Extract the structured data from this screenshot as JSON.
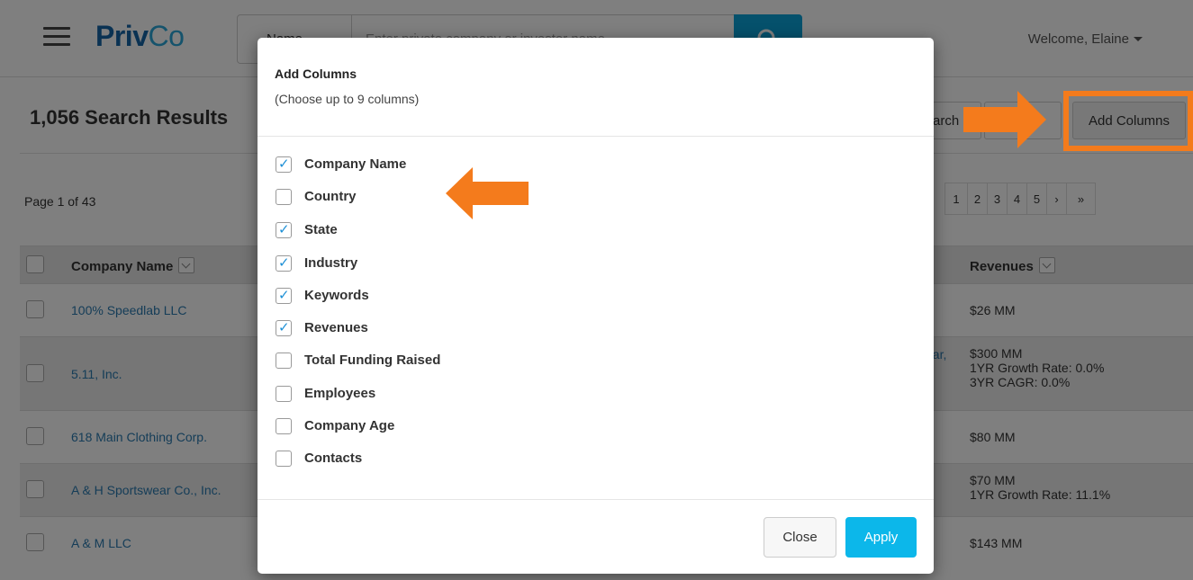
{
  "topbar": {
    "logo_part1": "Priv",
    "logo_part2": "Co",
    "search_type": "Name",
    "search_placeholder": "Enter private company or investor name",
    "welcome": "Welcome,  Elaine"
  },
  "results": {
    "title": "1,056 Search Results",
    "search_btn_fragment": "arch",
    "more_btn_fragment": "",
    "add_columns_label": "Add Columns",
    "page_info": "Page 1 of 43",
    "pages": [
      "1",
      "2",
      "3",
      "4",
      "5",
      "›",
      "»"
    ]
  },
  "table": {
    "col_name": "Company Name",
    "col_revenues": "Revenues",
    "keyword_fragment": "ear,",
    "rows": [
      {
        "name": "100% Speedlab LLC",
        "rev1": "$26 MM",
        "rev2": "",
        "rev3": ""
      },
      {
        "name": "5.11, Inc.",
        "rev1": "$300 MM",
        "rev2": "1YR Growth Rate: 0.0%",
        "rev3": "3YR CAGR: 0.0%"
      },
      {
        "name": "618 Main Clothing Corp.",
        "rev1": "$80 MM",
        "rev2": "",
        "rev3": ""
      },
      {
        "name": "A & H Sportswear Co., Inc.",
        "rev1": "$70 MM",
        "rev2": "1YR Growth Rate: 11.1%",
        "rev3": ""
      },
      {
        "name": "A & M LLC",
        "rev1": "$143 MM",
        "rev2": "",
        "rev3": ""
      }
    ]
  },
  "modal": {
    "title": "Add Columns",
    "subtitle": "(Choose up to 9 columns)",
    "options": [
      {
        "label": "Company Name",
        "checked": true
      },
      {
        "label": "Country",
        "checked": false
      },
      {
        "label": "State",
        "checked": true
      },
      {
        "label": "Industry",
        "checked": true
      },
      {
        "label": "Keywords",
        "checked": true
      },
      {
        "label": "Revenues",
        "checked": true
      },
      {
        "label": "Total Funding Raised",
        "checked": false
      },
      {
        "label": "Employees",
        "checked": false
      },
      {
        "label": "Company Age",
        "checked": false
      },
      {
        "label": "Contacts",
        "checked": false
      }
    ],
    "close_label": "Close",
    "apply_label": "Apply"
  },
  "colors": {
    "accent": "#0cb7ea",
    "annotation": "#f47b1c",
    "link": "#2a7ab0"
  }
}
